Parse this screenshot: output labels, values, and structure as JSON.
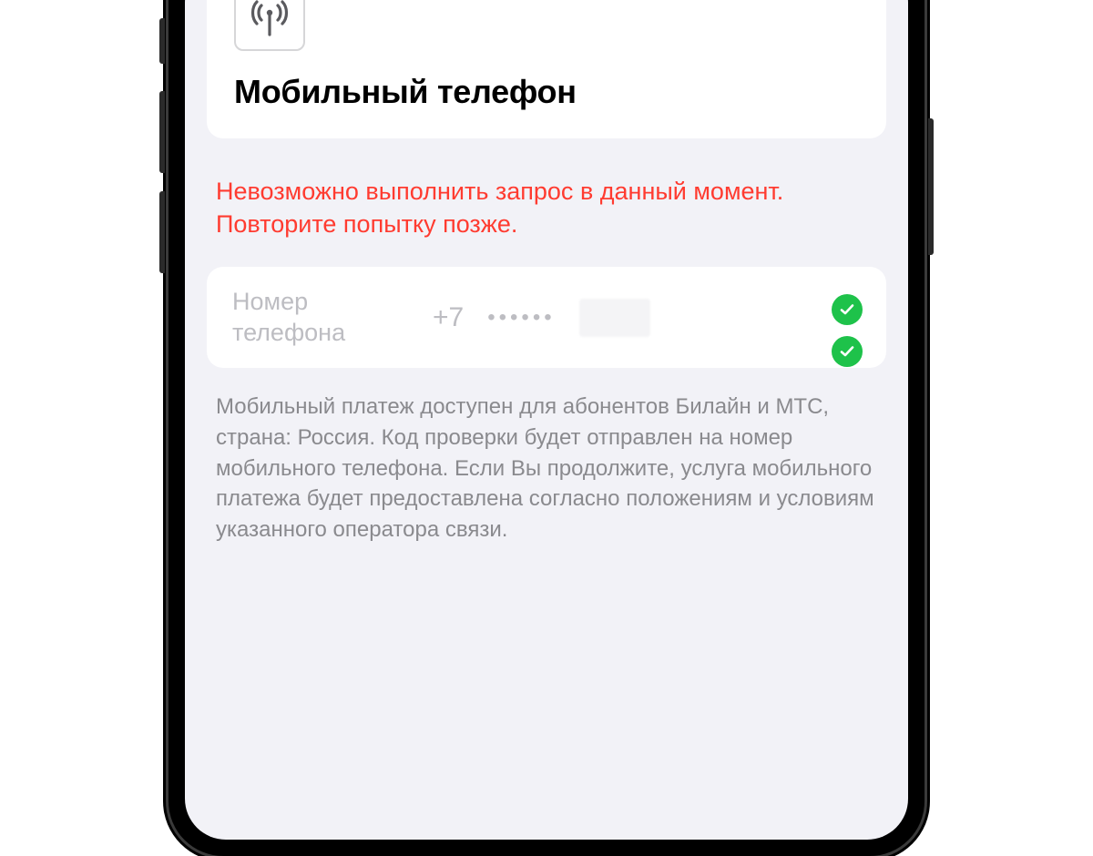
{
  "header": {
    "title": "Мобильный телефон",
    "icon": "antenna-icon"
  },
  "error": {
    "message": "Невозможно выполнить запрос в данный момент. Повторите попытку позже."
  },
  "phone_field": {
    "label": "Номер телефона",
    "prefix": "+7",
    "masked": "••••••"
  },
  "description": {
    "text": "Мобильный платеж доступен для абонентов Билайн и МТС, страна: Россия. Код проверки будет отправлен на номер мобильного телефона. Если Вы продолжите, услуга мобильного платежа будет предоставлена согласно положениям и условиям указанного оператора связи."
  },
  "colors": {
    "error": "#ff3b30",
    "success": "#1ec24a",
    "background": "#f2f2f7",
    "muted": "#8a8a8e"
  }
}
